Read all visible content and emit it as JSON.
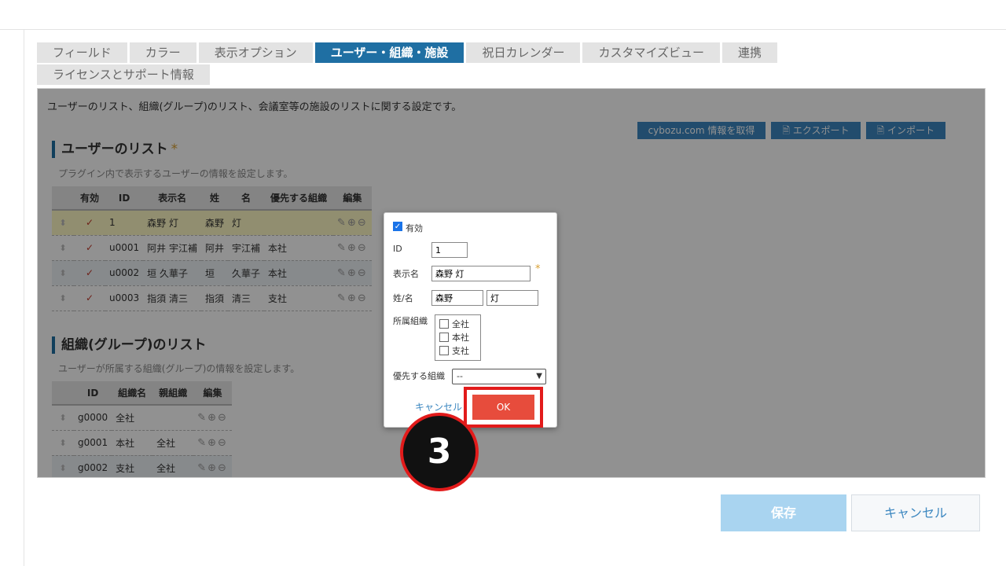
{
  "tabs": {
    "row1": [
      "フィールド",
      "カラー",
      "表示オプション",
      "ユーザー・組織・施設",
      "祝日カレンダー",
      "カスタマイズビュー",
      "連携"
    ],
    "row2": [
      "ライセンスとサポート情報"
    ],
    "active": "ユーザー・組織・施設"
  },
  "panel": {
    "description": "ユーザーのリスト、組織(グループ)のリスト、会議室等の施設のリストに関する設定です。",
    "buttons": {
      "cybozu": "cybozu.com 情報を取得",
      "export": "エクスポート",
      "import": "インポート"
    }
  },
  "users": {
    "title": "ユーザーのリスト",
    "required_mark": "*",
    "subtitle": "プラグイン内で表示するユーザーの情報を設定します。",
    "headers": [
      "有効",
      "ID",
      "表示名",
      "姓",
      "名",
      "優先する組織",
      "編集"
    ],
    "rows": [
      {
        "valid": "✓",
        "id": "1",
        "display": "森野 灯",
        "last": "森野",
        "first": "灯",
        "org": ""
      },
      {
        "valid": "✓",
        "id": "u0001",
        "display": "阿井 宇江補",
        "last": "阿井",
        "first": "宇江補",
        "org": "本社"
      },
      {
        "valid": "✓",
        "id": "u0002",
        "display": "垣 久華子",
        "last": "垣",
        "first": "久華子",
        "org": "本社"
      },
      {
        "valid": "✓",
        "id": "u0003",
        "display": "指須 清三",
        "last": "指須",
        "first": "清三",
        "org": "支社"
      }
    ]
  },
  "orgs": {
    "title": "組織(グループ)のリスト",
    "subtitle": "ユーザーが所属する組織(グループ)の情報を設定します。",
    "headers": [
      "ID",
      "組織名",
      "親組織",
      "編集"
    ],
    "rows": [
      {
        "id": "g0000",
        "name": "全社",
        "parent": ""
      },
      {
        "id": "g0001",
        "name": "本社",
        "parent": "全社"
      },
      {
        "id": "g0002",
        "name": "支社",
        "parent": "全社"
      }
    ]
  },
  "dialog": {
    "valid_label": "有効",
    "id_label": "ID",
    "id_value": "1",
    "display_label": "表示名",
    "display_value": "森野 灯",
    "required_mark": "*",
    "name_label": "姓/名",
    "last_value": "森野",
    "first_value": "灯",
    "org_label": "所属組織",
    "org_options": [
      "全社",
      "本社",
      "支社"
    ],
    "priority_label": "優先する組織",
    "priority_value": "--",
    "cancel": "キャンセル",
    "ok": "OK"
  },
  "step_marker": "3",
  "footer": {
    "save": "保存",
    "cancel": "キャンセル"
  },
  "colors": {
    "tab_active": "#1f6fa3",
    "ok_button": "#e74c3c",
    "highlight": "#e21b1b",
    "save_button": "#a9d4f0"
  }
}
